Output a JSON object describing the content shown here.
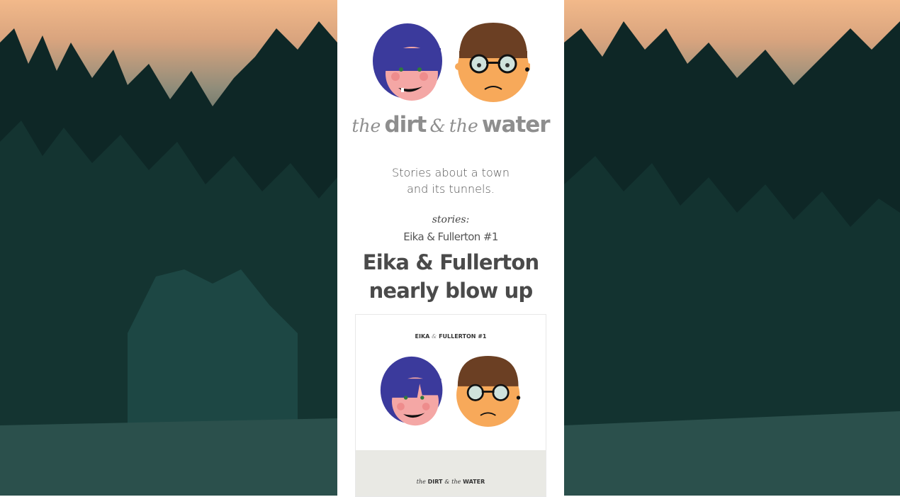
{
  "site": {
    "title_parts": [
      "the",
      "dirt",
      "&",
      "the",
      "water"
    ],
    "tagline_line1": "Stories about a town",
    "tagline_line2": "and its tunnels."
  },
  "stories": {
    "label": "stories:",
    "subtitle": "Eika & Fullerton #1",
    "title_line1": "Eika & Fullerton",
    "title_line2": "nearly blow up"
  },
  "cover": {
    "heading_a": "EIKA",
    "heading_amp": "&",
    "heading_b": "FULLERTON #1",
    "footer_a": "the",
    "footer_b": "DIRT",
    "footer_c": "&",
    "footer_d": "the",
    "footer_e": "WATER"
  },
  "colors": {
    "column_bg": "#ffffff",
    "title_grey": "#8e8e8e",
    "eika_hair": "#3b3a9c",
    "eika_skin": "#f4a7a5",
    "fullerton_hair": "#6b3f23",
    "fullerton_skin": "#f7a95a",
    "cover_band": "#e9e9e4"
  }
}
